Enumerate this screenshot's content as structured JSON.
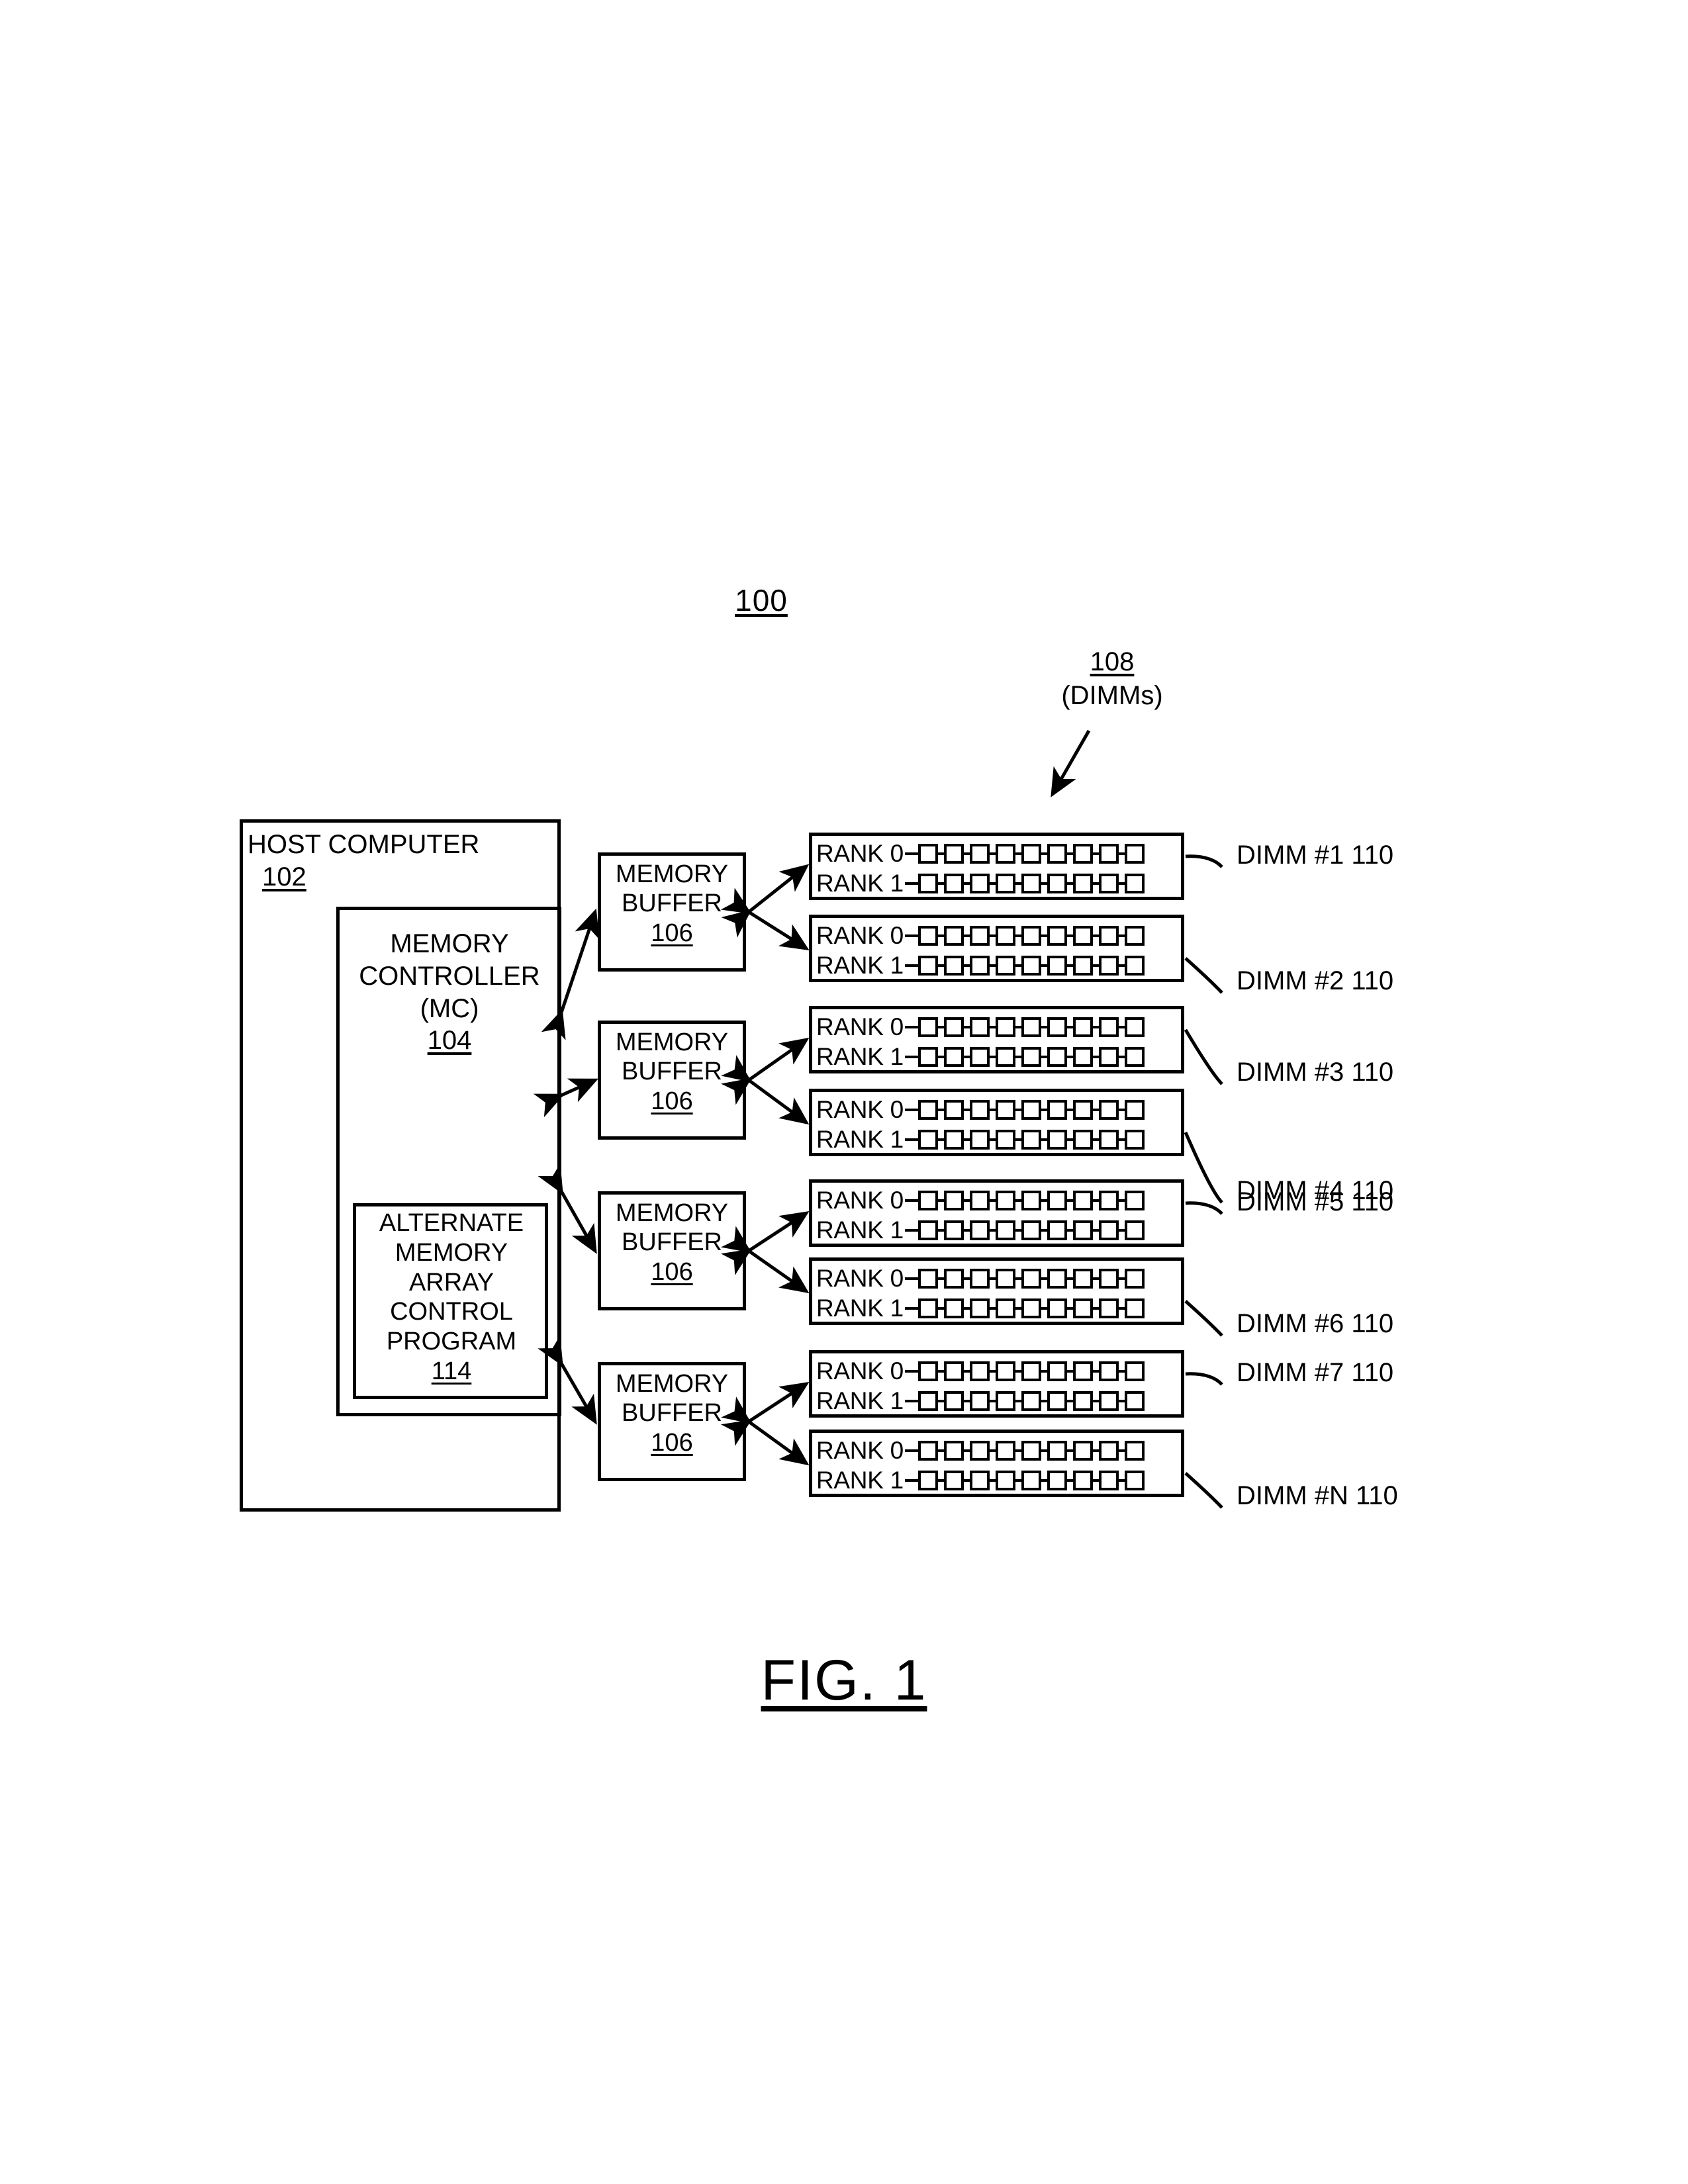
{
  "figure": {
    "system_ref": "100",
    "caption": "FIG. 1"
  },
  "dimms_callout": {
    "ref": "108",
    "sublabel": "(DIMMs)"
  },
  "host_computer": {
    "title": "HOST COMPUTER",
    "ref": "102"
  },
  "memory_controller": {
    "line1": "MEMORY",
    "line2": "CONTROLLER",
    "line3": "(MC)",
    "ref": "104"
  },
  "alternate_memory_array_control_program": {
    "line1": "ALTERNATE",
    "line2": "MEMORY",
    "line3": "ARRAY",
    "line4": "CONTROL",
    "line5": "PROGRAM",
    "ref": "114"
  },
  "memory_buffers": [
    {
      "line1": "MEMORY",
      "line2": "BUFFER",
      "ref": "106"
    },
    {
      "line1": "MEMORY",
      "line2": "BUFFER",
      "ref": "106"
    },
    {
      "line1": "MEMORY",
      "line2": "BUFFER",
      "ref": "106"
    },
    {
      "line1": "MEMORY",
      "line2": "BUFFER",
      "ref": "106"
    }
  ],
  "rank_labels": {
    "rank0": "RANK 0",
    "rank1": "RANK 1"
  },
  "chips_per_rank": 9,
  "dimms": [
    {
      "label": "DIMM #1 110"
    },
    {
      "label": "DIMM #2 110"
    },
    {
      "label": "DIMM #3 110"
    },
    {
      "label": "DIMM #4 110"
    },
    {
      "label": "DIMM #5 110"
    },
    {
      "label": "DIMM #6 110"
    },
    {
      "label": "DIMM #7 110"
    },
    {
      "label": "DIMM #N 110"
    }
  ],
  "colors": {
    "ink": "#000000",
    "paper": "#ffffff"
  }
}
